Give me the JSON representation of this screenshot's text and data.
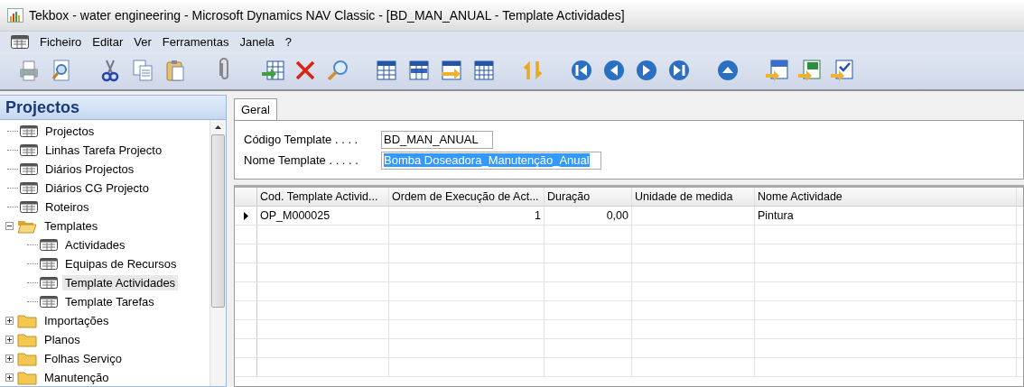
{
  "window": {
    "title": "Tekbox - water engineering - Microsoft Dynamics NAV Classic - [BD_MAN_ANUAL - Template Actividades]"
  },
  "menu": [
    "Ficheiro",
    "Editar",
    "Ver",
    "Ferramentas",
    "Janela",
    "?"
  ],
  "sidebar": {
    "title": "Projectos",
    "items": [
      {
        "label": "Projectos",
        "kind": "form",
        "selected": false
      },
      {
        "label": "Linhas Tarefa Projecto",
        "kind": "form",
        "selected": false
      },
      {
        "label": "Diários Projectos",
        "kind": "form",
        "selected": false
      },
      {
        "label": "Diários CG Projecto",
        "kind": "form",
        "selected": false
      },
      {
        "label": "Roteiros",
        "kind": "form",
        "selected": false
      },
      {
        "label": "Templates",
        "kind": "folder",
        "expanded": true,
        "selected": false,
        "children": [
          {
            "label": "Actividades",
            "kind": "form",
            "selected": false
          },
          {
            "label": "Equipas de Recursos",
            "kind": "form",
            "selected": false
          },
          {
            "label": "Template Actividades",
            "kind": "form",
            "selected": true
          },
          {
            "label": "Template Tarefas",
            "kind": "form",
            "selected": false
          }
        ]
      },
      {
        "label": "Importações",
        "kind": "folder",
        "expanded": false,
        "selected": false
      },
      {
        "label": "Planos",
        "kind": "folder",
        "expanded": false,
        "selected": false
      },
      {
        "label": "Folhas Serviço",
        "kind": "folder",
        "expanded": false,
        "selected": false
      },
      {
        "label": "Manutenção",
        "kind": "folder",
        "expanded": false,
        "selected": false
      }
    ]
  },
  "form": {
    "tabs": [
      {
        "label": "Geral",
        "selected": true
      }
    ],
    "fields": [
      {
        "label": "Código Template . . . .",
        "value": "BD_MAN_ANUAL",
        "selected": false
      },
      {
        "label": "Nome Template . . . . .",
        "value": "Bomba Doseadora_Manutenção_Anual",
        "selected": true
      }
    ]
  },
  "table": {
    "columns": [
      "Cod. Template Activid...",
      "Ordem de Execução de Act...",
      "Duração",
      "Unidade de medida",
      "Nome Actividade"
    ],
    "rows": [
      {
        "current": true,
        "cells": [
          "OP_M000025",
          "1",
          "0,00",
          "",
          "Pintura"
        ]
      }
    ]
  }
}
